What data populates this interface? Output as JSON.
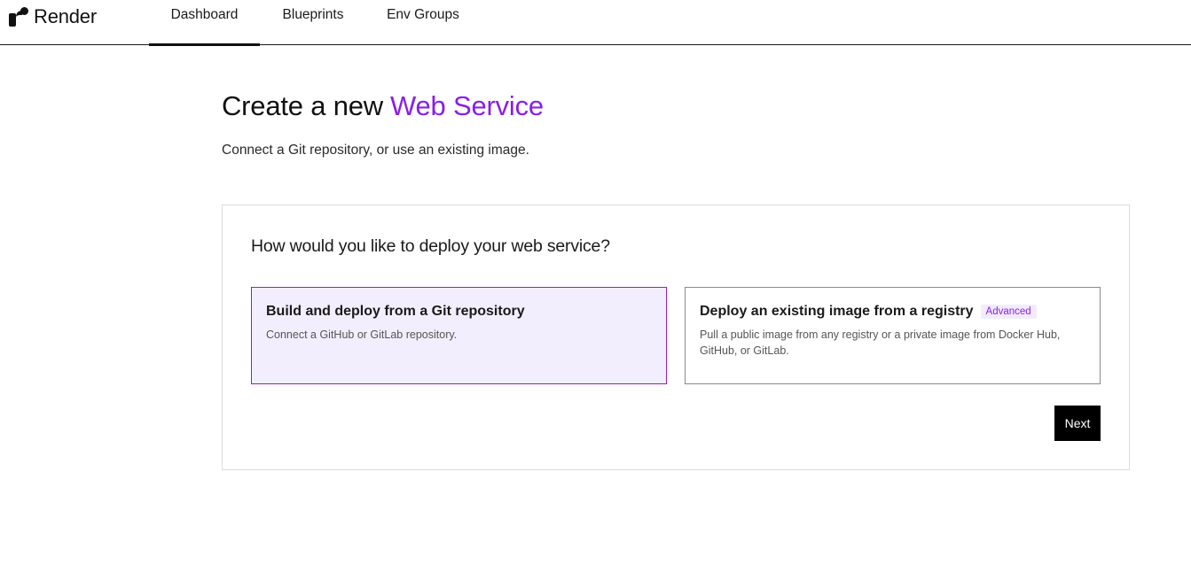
{
  "app": {
    "name": "Render"
  },
  "nav": {
    "tabs": [
      {
        "label": "Dashboard",
        "active": true
      },
      {
        "label": "Blueprints",
        "active": false
      },
      {
        "label": "Env Groups",
        "active": false
      }
    ]
  },
  "header": {
    "title_prefix": "Create a new",
    "title_accent": "Web Service",
    "subtitle": "Connect a Git repository, or use an existing image."
  },
  "deploy": {
    "question": "How would you like to deploy your web service?",
    "options": [
      {
        "title": "Build and deploy from a Git repository",
        "description": "Connect a GitHub or GitLab repository.",
        "selected": true
      },
      {
        "title": "Deploy an existing image from a registry",
        "badge": "Advanced",
        "description": "Pull a public image from any registry or a private image from Docker Hub, GitHub, or GitLab.",
        "selected": false
      }
    ],
    "next_label": "Next"
  },
  "colors": {
    "accent": "#8a1ee6",
    "selected_border": "#9a1ea8",
    "selected_bg": "#f3eefe",
    "button_bg": "#000000"
  },
  "icons": {
    "logo": "render-logo-icon"
  }
}
